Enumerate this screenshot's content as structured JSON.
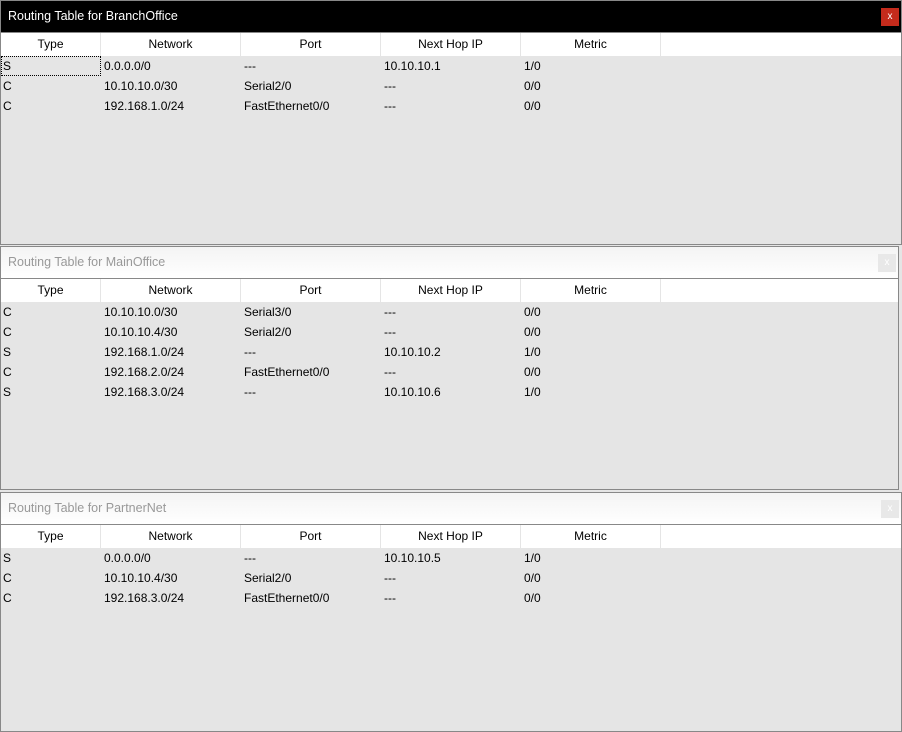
{
  "columns": [
    "Type",
    "Network",
    "Port",
    "Next Hop IP",
    "Metric"
  ],
  "close_label": "x",
  "windows": [
    {
      "title": "Routing Table for BranchOffice",
      "rows": [
        [
          "S",
          "0.0.0.0/0",
          "---",
          "10.10.10.1",
          "1/0"
        ],
        [
          "C",
          "10.10.10.0/30",
          "Serial2/0",
          "---",
          "0/0"
        ],
        [
          "C",
          "192.168.1.0/24",
          "FastEthernet0/0",
          "---",
          "0/0"
        ]
      ]
    },
    {
      "title": "Routing Table for MainOffice",
      "rows": [
        [
          "C",
          "10.10.10.0/30",
          "Serial3/0",
          "---",
          "0/0"
        ],
        [
          "C",
          "10.10.10.4/30",
          "Serial2/0",
          "---",
          "0/0"
        ],
        [
          "S",
          "192.168.1.0/24",
          "---",
          "10.10.10.2",
          "1/0"
        ],
        [
          "C",
          "192.168.2.0/24",
          "FastEthernet0/0",
          "---",
          "0/0"
        ],
        [
          "S",
          "192.168.3.0/24",
          "---",
          "10.10.10.6",
          "1/0"
        ]
      ]
    },
    {
      "title": "Routing Table for PartnerNet",
      "rows": [
        [
          "S",
          "0.0.0.0/0",
          "---",
          "10.10.10.5",
          "1/0"
        ],
        [
          "C",
          "10.10.10.4/30",
          "Serial2/0",
          "---",
          "0/0"
        ],
        [
          "C",
          "192.168.3.0/24",
          "FastEthernet0/0",
          "---",
          "0/0"
        ]
      ]
    }
  ]
}
